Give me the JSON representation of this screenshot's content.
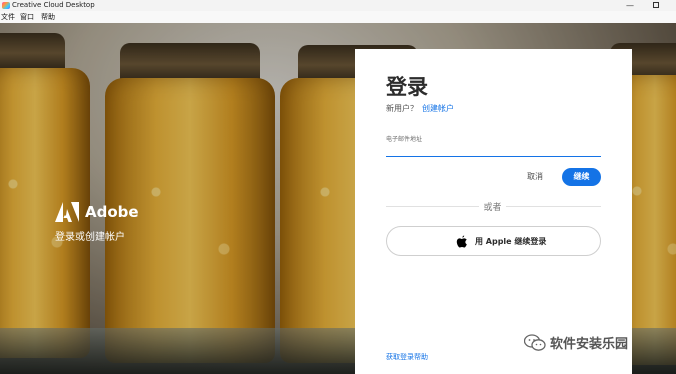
{
  "window": {
    "title": "Creative Cloud Desktop",
    "minimize_glyph": "—"
  },
  "menu": {
    "items": [
      {
        "label": "文件"
      },
      {
        "label": "窗口"
      },
      {
        "label": "帮助"
      }
    ]
  },
  "hero": {
    "brand": "Adobe",
    "subtitle": "登录或创建帐户"
  },
  "login": {
    "title": "登录",
    "new_user_text": "新用户？",
    "create_account_link": "创建帐户",
    "email_label": "电子邮件地址",
    "email_value": "",
    "cancel_label": "取消",
    "continue_label": "继续",
    "or_text": "或者",
    "apple_button_label": "用 Apple 继续登录",
    "help_link": "获取登录帮助"
  },
  "watermark": {
    "text": "软件安装乐园"
  },
  "colors": {
    "accent": "#1473e6",
    "card_background": "#ffffff"
  },
  "icons": {
    "app": "creative-cloud-icon",
    "adobe_logo": "adobe-logo-icon",
    "apple": "apple-icon",
    "watermark": "wechat-icon"
  }
}
